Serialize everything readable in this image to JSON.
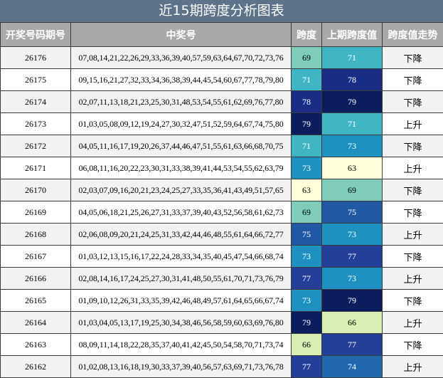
{
  "title": "近15期跨度分析图表",
  "headers": [
    "开奖号码期号",
    "中奖号",
    "跨度",
    "上期跨度值",
    "跨度值走势"
  ],
  "rows": [
    {
      "period": "26176",
      "numbers": "07,08,14,21,22,26,29,33,36,39,40,57,59,63,64,67,70,72,73,76",
      "span": "69",
      "prev_span": "71",
      "trend": "下降"
    },
    {
      "period": "26175",
      "numbers": "09,15,16,21,27,32,33,34,36,38,39,44,45,54,60,67,77,78,79,80",
      "span": "71",
      "prev_span": "78",
      "trend": "下降"
    },
    {
      "period": "26174",
      "numbers": "02,07,11,13,18,21,23,25,30,31,48,53,54,55,61,62,69,76,77,80",
      "span": "78",
      "prev_span": "79",
      "trend": "下降"
    },
    {
      "period": "26173",
      "numbers": "01,03,05,08,09,12,19,24,27,30,32,47,51,52,59,64,67,74,75,80",
      "span": "79",
      "prev_span": "71",
      "trend": "上升"
    },
    {
      "period": "26172",
      "numbers": "04,05,11,16,17,19,20,26,37,44,46,47,51,55,61,63,66,68,70,75",
      "span": "71",
      "prev_span": "73",
      "trend": "下降"
    },
    {
      "period": "26171",
      "numbers": "06,08,11,16,20,22,23,30,31,33,38,39,41,44,53,54,55,62,63,79",
      "span": "73",
      "prev_span": "63",
      "trend": "上升"
    },
    {
      "period": "26170",
      "numbers": "02,03,07,09,16,20,21,23,24,25,27,33,35,36,41,43,49,51,57,65",
      "span": "63",
      "prev_span": "69",
      "trend": "下降"
    },
    {
      "period": "26169",
      "numbers": "04,05,06,18,21,25,26,27,31,33,37,39,40,43,52,56,58,61,62,73",
      "span": "69",
      "prev_span": "75",
      "trend": "下降"
    },
    {
      "period": "26168",
      "numbers": "02,06,08,09,20,21,24,25,31,33,42,44,46,48,55,61,64,66,72,77",
      "span": "75",
      "prev_span": "73",
      "trend": "上升"
    },
    {
      "period": "26167",
      "numbers": "01,03,12,13,15,16,17,22,24,28,33,34,35,40,45,47,54,66,68,74",
      "span": "73",
      "prev_span": "77",
      "trend": "下降"
    },
    {
      "period": "26166",
      "numbers": "02,08,14,16,17,24,25,27,30,31,41,48,50,55,61,70,71,73,76,79",
      "span": "77",
      "prev_span": "73",
      "trend": "上升"
    },
    {
      "period": "26165",
      "numbers": "01,09,10,12,26,31,33,35,39,42,46,48,49,57,61,64,65,66,67,74",
      "span": "73",
      "prev_span": "79",
      "trend": "下降"
    },
    {
      "period": "26164",
      "numbers": "01,03,04,05,13,17,19,25,30,34,38,46,56,58,59,60,63,69,76,80",
      "span": "79",
      "prev_span": "66",
      "trend": "上升"
    },
    {
      "period": "26163",
      "numbers": "08,09,11,14,18,22,28,35,37,40,41,42,45,50,54,58,70,71,73,74",
      "span": "66",
      "prev_span": "77",
      "trend": "下降"
    },
    {
      "period": "26162",
      "numbers": "01,02,08,13,16,18,19,30,33,37,39,40,56,57,63,69,71,73,76,78",
      "span": "77",
      "prev_span": "74",
      "trend": "上升"
    }
  ]
}
